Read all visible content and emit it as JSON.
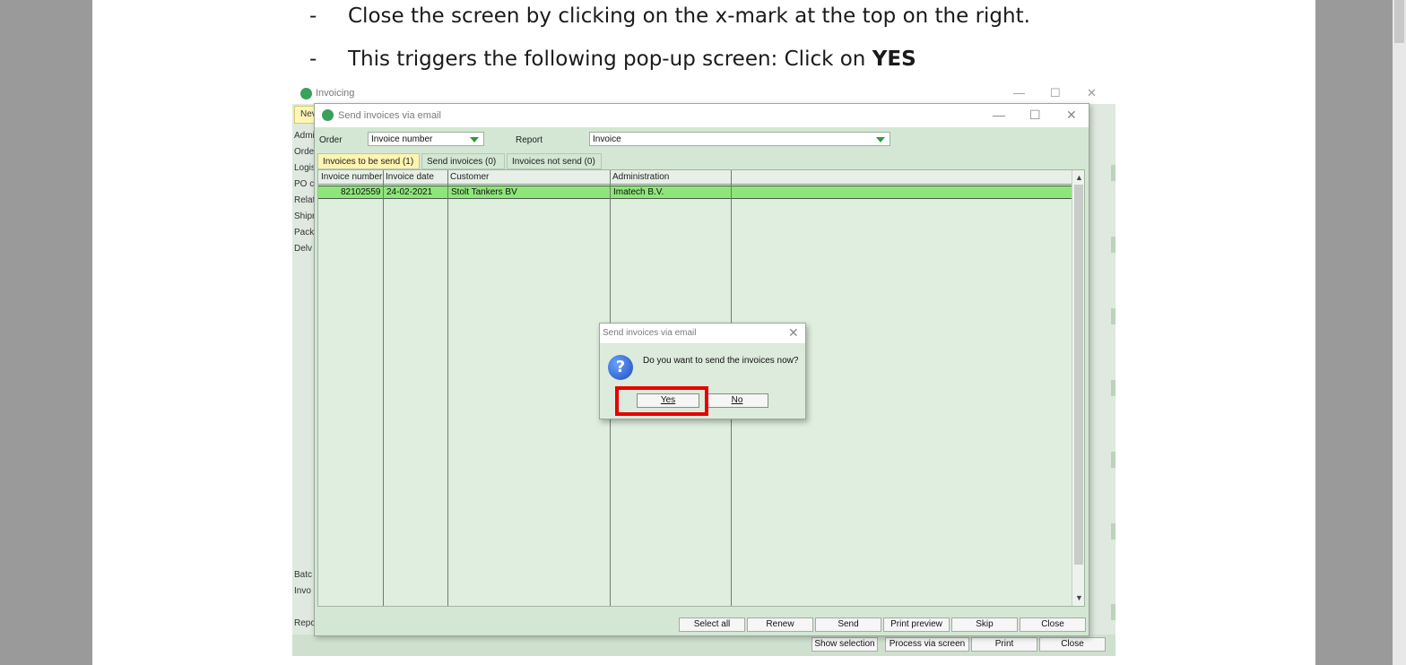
{
  "document": {
    "line1": {
      "dash": "-",
      "text": "Close the screen by clicking on the x-mark at the top on the right."
    },
    "line2": {
      "dash": "-",
      "text": "This triggers the following pop-up screen: Click on ",
      "bold": "YES"
    }
  },
  "background_window": {
    "title": "Invoicing",
    "new_button": "Nev",
    "side_labels": [
      "Admi",
      "Orde",
      "Logis",
      "PO c",
      "Relat",
      "Shipr",
      "Packi",
      "Delv",
      "Batc",
      "Invo",
      "Repc"
    ],
    "bottom_buttons": [
      "Show selection",
      "Process via screen",
      "Print",
      "Close"
    ],
    "controls": {
      "minimize": "—",
      "maximize": "☐",
      "close": "✕"
    }
  },
  "send_window": {
    "title": "Send invoices via email",
    "controls": {
      "minimize": "—",
      "maximize": "☐",
      "close": "✕"
    },
    "order_label": "Order",
    "order_value": "Invoice number",
    "report_label": "Report",
    "report_value": "Invoice",
    "tabs": [
      {
        "label": "Invoices to be send (1)",
        "active": true
      },
      {
        "label": "Send invoices (0)",
        "active": false
      },
      {
        "label": "Invoices not send (0)",
        "active": false
      }
    ],
    "columns": [
      "Invoice number",
      "Invoice date",
      "Customer",
      "Administration"
    ],
    "rows": [
      {
        "invoice_number": "82102559",
        "invoice_date": "24-02-2021",
        "customer": "Stolt Tankers BV",
        "administration": "Imatech B.V."
      }
    ],
    "bottom_buttons": [
      "Select all",
      "Renew",
      "Send",
      "Print preview",
      "Skip",
      "Close"
    ]
  },
  "dialog": {
    "title": "Send invoices via email",
    "close": "✕",
    "icon": "question-icon",
    "icon_glyph": "?",
    "message": "Do you want to send the invoices now?",
    "yes_label": "Yes",
    "no_label": "No"
  },
  "colors": {
    "highlight": "#e60000",
    "selected_row": "#8ee67a",
    "active_tab": "#fff4b0",
    "window_bg": "#d4e6d4"
  }
}
